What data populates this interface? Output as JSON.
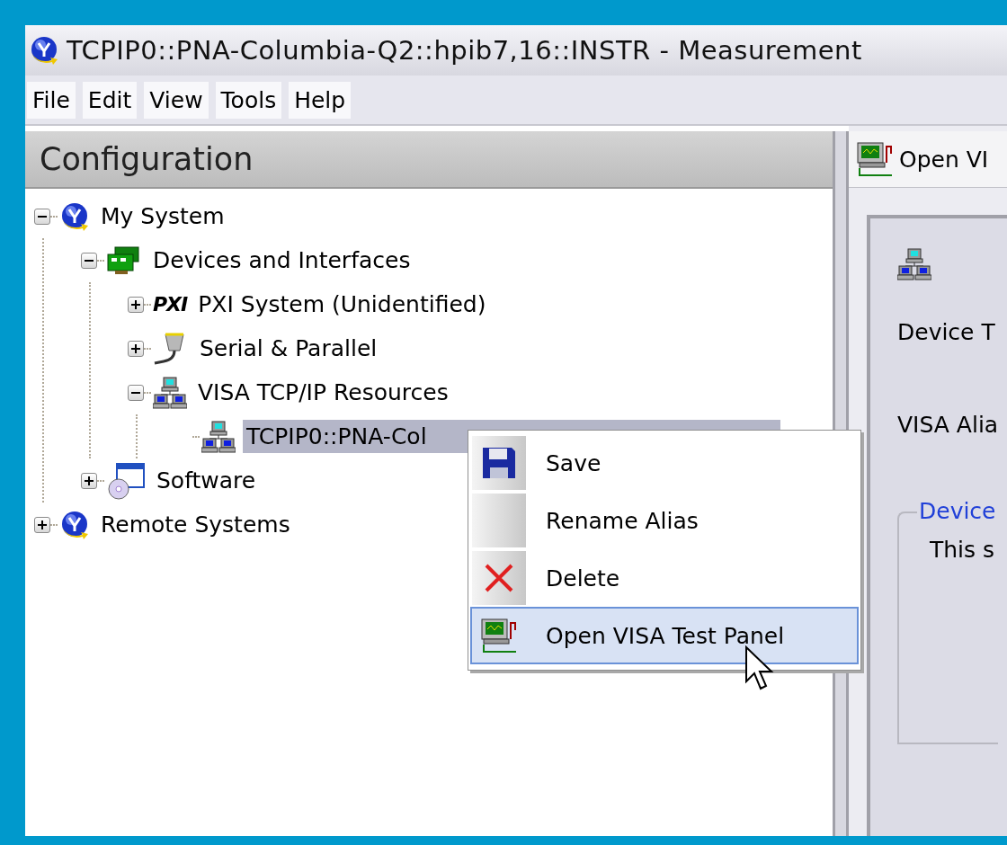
{
  "window": {
    "title": "TCPIP0::PNA-Columbia-Q2::hpib7,16::INSTR - Measurement"
  },
  "menu_bar": [
    "File",
    "Edit",
    "View",
    "Tools",
    "Help"
  ],
  "configuration": {
    "title": "Configuration",
    "tree": [
      {
        "label": "My System",
        "kind": "globe",
        "expanded": true,
        "selected": false,
        "children": [
          {
            "label": "Devices and Interfaces",
            "kind": "card",
            "expanded": true,
            "selected": false,
            "children": [
              {
                "label": "PXI System (Unidentified)",
                "kind": "pxi",
                "badge": "PXI",
                "expanded": false,
                "selected": false
              },
              {
                "label": "Serial & Parallel",
                "kind": "serial",
                "expanded": false,
                "selected": false
              },
              {
                "label": "VISA TCP/IP Resources",
                "kind": "network",
                "expanded": true,
                "selected": false,
                "children": [
                  {
                    "label": "TCPIP0::PNA-Col",
                    "kind": "network",
                    "selected": true
                  }
                ]
              }
            ]
          },
          {
            "label": "Software",
            "kind": "software",
            "expanded": false,
            "selected": false
          }
        ]
      },
      {
        "label": "Remote Systems",
        "kind": "globe",
        "expanded": false,
        "selected": false
      }
    ]
  },
  "context_menu": [
    {
      "label": "Save",
      "kind": "save",
      "selected": false
    },
    {
      "label": "Rename Alias",
      "kind": "text",
      "selected": false
    },
    {
      "label": "Delete",
      "kind": "delete",
      "selected": false
    },
    {
      "label": "Open VISA Test Panel",
      "kind": "visa",
      "selected": true
    }
  ],
  "right_pane": {
    "toolbar_button": "Open VI",
    "fields": [
      "Device T",
      "VISA Alia"
    ],
    "group": {
      "legend": "Device",
      "text": "This s"
    }
  }
}
